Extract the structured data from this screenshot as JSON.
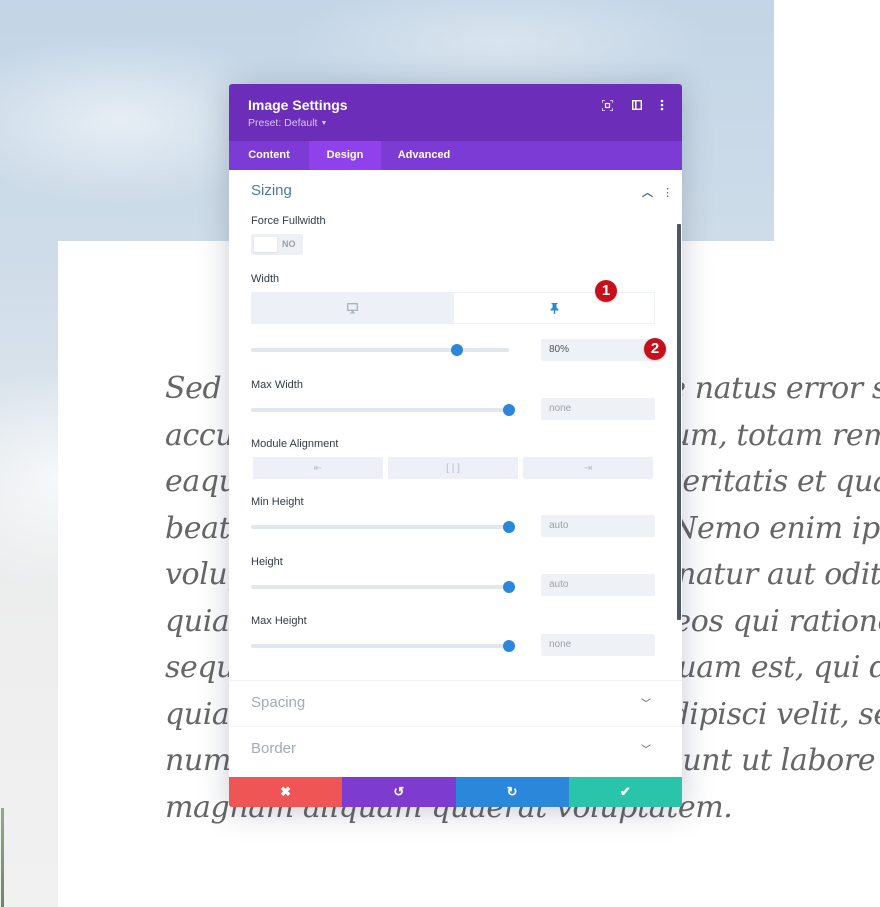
{
  "background": {
    "body_text_lines": [
      "Sed ut perspiciatis unde omnis iste natus error sit vo",
      "accusantium doloremque laudantium, totam rem ap",
      "eaque ipsa quae ab illo inventore veritatis et quasi ar",
      "beatae vitae dicta sunt explicabo. Nemo enim ipsam",
      "voluptatem quia voluptas sit aspernatur aut odit aut",
      "quia consequuntur magni dolores eos qui ratione vol",
      "sequi nesciunt. Neque porro quisquam est, qui dolore",
      "quia dolor sit amet, consectetur, adipisci velit, sed qu",
      "numquam eius modi tempora incidunt ut labore et d",
      "magnam aliquam quaerat voluptatem."
    ]
  },
  "modal": {
    "title": "Image Settings",
    "preset_label": "Preset: Default",
    "header_icons": [
      "focus-mode-icon",
      "split-view-icon",
      "more-options-icon"
    ],
    "tabs": [
      {
        "label": "Content",
        "active": false
      },
      {
        "label": "Design",
        "active": true
      },
      {
        "label": "Advanced",
        "active": false
      }
    ],
    "sections": {
      "sizing": {
        "title": "Sizing",
        "expanded": true,
        "force_fullwidth": {
          "label": "Force Fullwidth",
          "value": "NO"
        },
        "width": {
          "label": "Width",
          "value": "80%",
          "slider_percent": 80,
          "device_tabs": [
            "desktop",
            "hover"
          ],
          "active_device": "hover"
        },
        "max_width": {
          "label": "Max Width",
          "value": "none",
          "slider_percent": 100
        },
        "module_alignment": {
          "label": "Module Alignment",
          "options": [
            "left",
            "center",
            "right"
          ]
        },
        "min_height": {
          "label": "Min Height",
          "value": "auto",
          "slider_percent": 100
        },
        "height": {
          "label": "Height",
          "value": "auto",
          "slider_percent": 100
        },
        "max_height": {
          "label": "Max Height",
          "value": "none",
          "slider_percent": 100
        }
      },
      "spacing": {
        "title": "Spacing",
        "expanded": false
      },
      "border": {
        "title": "Border",
        "expanded": false
      }
    },
    "badges": [
      "1",
      "2"
    ],
    "footer": {
      "cancel": {
        "icon": "close-icon",
        "color": "#ef5555"
      },
      "undo": {
        "icon": "undo-icon",
        "color": "#7e3bd0"
      },
      "redo": {
        "icon": "redo-icon",
        "color": "#2b87da"
      },
      "save": {
        "icon": "check-icon",
        "color": "#29c4a9"
      }
    }
  },
  "colors": {
    "header": "#6c2eb9",
    "tabs": "#7d3bd6",
    "active_tab": "#8f42ec",
    "accent_blue": "#2b87da",
    "badge_red": "#c8101d"
  }
}
